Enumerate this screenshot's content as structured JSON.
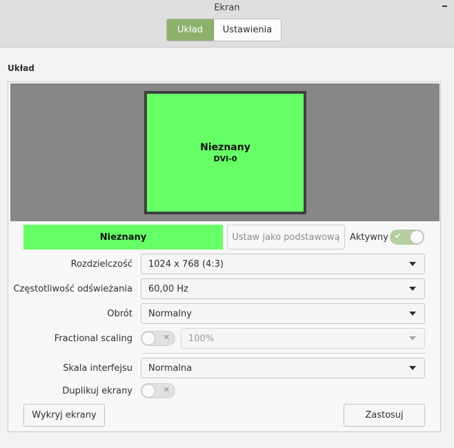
{
  "window": {
    "title": "Ekran"
  },
  "stack": {
    "tabs": [
      "Układ",
      "Ustawienia"
    ],
    "active": "Układ"
  },
  "layout": {
    "section_title": "Układ"
  },
  "monitor": {
    "name": "Nieznany",
    "port": "DVI-0",
    "color": "#66ff66"
  },
  "controls": {
    "monitor_name": "Nieznany",
    "set_primary_label": "Ustaw jako podstawową",
    "active_label": "Aktywny",
    "active_on": true
  },
  "form": {
    "resolution": {
      "label": "Rozdzielczość",
      "value": "1024 x 768 (4:3)"
    },
    "refresh": {
      "label": "Częstotliwość odświeżania",
      "value": "60,00 Hz"
    },
    "rotation": {
      "label": "Obrót",
      "value": "Normalny"
    },
    "fractional": {
      "label": "Fractional scaling",
      "value": "100%",
      "enabled": false
    },
    "ui_scale": {
      "label": "Skala interfejsu",
      "value": "Normalna"
    },
    "mirror": {
      "label": "Duplikuj ekrany",
      "enabled": false
    }
  },
  "buttons": {
    "detect": "Wykryj ekrany",
    "apply": "Zastosuj"
  },
  "colors": {
    "accent": "#8bb16c",
    "toggle_on": "#b5cfa0"
  }
}
